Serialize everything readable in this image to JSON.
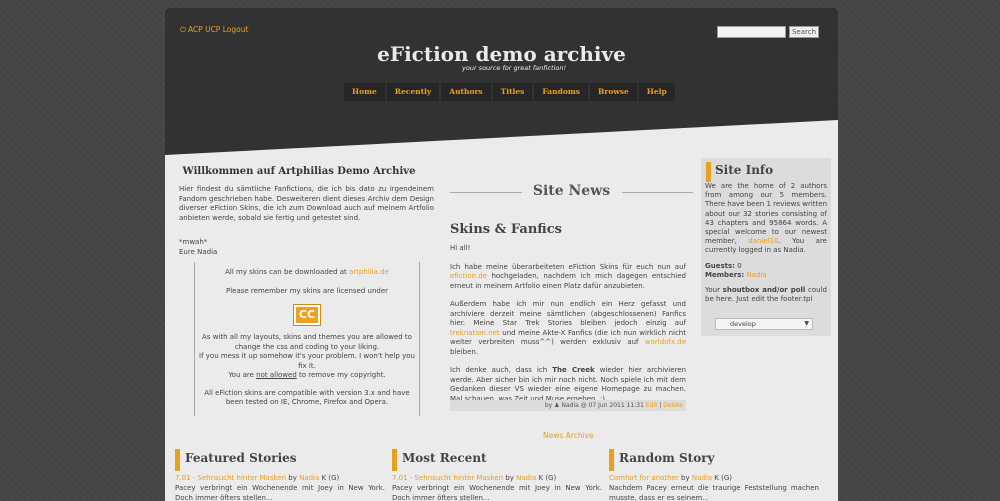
{
  "topbar": {
    "links": "ACP UCP Logout",
    "search_button": "Search",
    "search_value": ""
  },
  "site": {
    "title": "eFiction demo archive",
    "slogan": "your source for great fanfiction!"
  },
  "nav": [
    "Home",
    "Recently",
    "Authors",
    "Titles",
    "Fandoms",
    "Browse",
    "Help"
  ],
  "welcome": {
    "title": "Willkommen auf Artphilias Demo Archive",
    "text": "Hier findest du sämtliche Fanfictions, die ich bis dato zu irgendeinem Fandom geschrieben habe. Desweiteren dient dieses Archiv dem Design diverser eFiction Skins, die ich zum Download auch auf meinem Artfolio anbieten werde, sobald sie fertig und getestet sind.",
    "sign1": "*mwah*",
    "sign2": "Eure Nadia"
  },
  "notice": {
    "download_prefix": "All my skins can be downloaded at ",
    "download_link": "artphilia.de",
    "licensed": "Please remember my skins are licensed under",
    "cc_label": "CC",
    "layouts": "As with all my layouts, skins and themes you are allowed to change the css and coding to your liking.",
    "mess": "If you mess it up somehow it's your problem. I won't help you fix it.",
    "not_allowed_prefix": "You are ",
    "not_allowed": "not allowed",
    "not_allowed_suffix": " to remove my copyright.",
    "compatible": "All eFiction skins are compatible with version 3.x and have been tested on IE, Chrome, Firefox and Opera."
  },
  "news": {
    "section_title": "Site News",
    "title": "Skins & Fanfics",
    "hi": "Hi all!",
    "p1_a": "Ich habe meine überarbeiteten eFiction Skins für euch nun auf ",
    "p1_link": "efiction.de",
    "p1_b": " hochgeladen, nachdem ich mich dagegen entschied erneut in meinem Artfolio einen Platz dafür anzubieten.",
    "p2_a": "Außerdem habe ich mir nun endlich ein Herz gefasst und archiviere derzeit meine sämtlichen (abgeschlossenen) Fanfics hier. Meine Star Trek Stories bleiben jedoch einzig auf ",
    "p2_link1": "treknation.net",
    "p2_b": " und meine Akte-X Fanfics (die ich nun wirklich nicht weiter verbreiten muss^^) werden exklusiv auf ",
    "p2_link2": "worldofx.de",
    "p2_c": " bleiben.",
    "p3_a": "Ich denke auch, dass ich ",
    "p3_bold": "The Creek",
    "p3_b": " wieder hier archivieren werde. Aber sicher bin ich mir noch nicht. Noch spiele ich mit dem Gedanken dieser VS wieder eine eigene Homepage zu machen. Mal schauen, was Zeit und Muse ergeben. :)",
    "footer_prefix": "by ",
    "footer_meta": "Nadia @ 07 Jun 2011 11:31 ",
    "footer_edit": "Edit",
    "footer_sep": " | ",
    "footer_delete": "Delete",
    "archive": "News Archive"
  },
  "sidebar": {
    "title": "Site Info",
    "p1_a": "We are the home of 2 authors from among our 5 members. There have been 1 reviews written about our 32 stories consisting of 43 chapters and 95864 words. A special welcome to our newest member, ",
    "p1_link": "daniel10",
    "p1_b": ". You are currently logged in as Nadia.",
    "guests_label": "Guests:",
    "guests_value": " 0",
    "members_label": "Members:",
    "members_value": " Nadia",
    "p3_a": "Your ",
    "p3_bold": "shoutbox and/or poll",
    "p3_b": " could be here. Just edit the footer.tpl",
    "select_value": "develop"
  },
  "bottom": [
    {
      "title": "Featured Stories",
      "story": "7.01 - Sehnsucht hinter Masken",
      "by": " by ",
      "author": "Nadia",
      "rating": " K (G)",
      "summary": "Pacey verbringt ein Wochenende mit Joey in New York. Doch immer öfters stellen..."
    },
    {
      "title": "Most Recent",
      "story": "7.01 - Sehnsucht hinter Masken",
      "by": " by ",
      "author": "Nadia",
      "rating": " K (G)",
      "summary": "Pacey verbringt ein Wochenende mit Joey in New York. Doch immer öfters stellen..."
    },
    {
      "title": "Random Story",
      "story": "Comfort for another",
      "by": " by ",
      "author": "Nadia",
      "rating": " K (G)",
      "summary": "Nachdem Pacey erneut die traurige Feststellung machen musste, dass er es seinem..."
    }
  ],
  "colors": {
    "accent": "#e8a020",
    "header": "#323232",
    "content": "#ebebeb"
  },
  "icons": {
    "power": "power-icon",
    "user": "user-icon",
    "select": "chevron-down-icon"
  }
}
